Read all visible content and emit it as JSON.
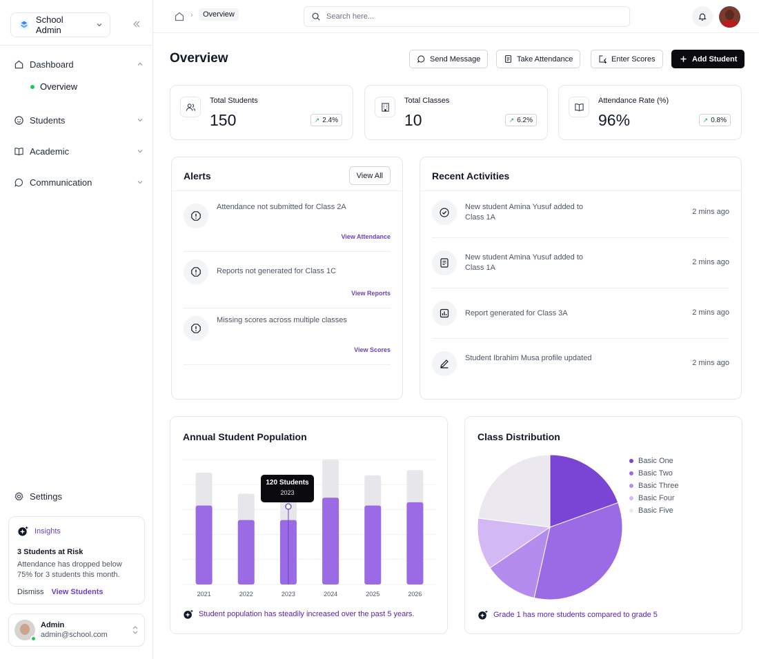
{
  "app": {
    "name": "School Admin"
  },
  "sidebar": {
    "nav": [
      {
        "label": "Dashboard",
        "icon": "home-icon",
        "expanded": true
      },
      {
        "label": "Students",
        "icon": "smile-icon",
        "expanded": false
      },
      {
        "label": "Academic",
        "icon": "book-icon",
        "expanded": false
      },
      {
        "label": "Communication",
        "icon": "chat-icon",
        "expanded": false
      }
    ],
    "subitem": {
      "label": "Overview"
    },
    "settings": {
      "label": "Settings"
    },
    "insights": {
      "title": "Insights",
      "headline": "3 Students at Risk",
      "text": "Attendance has dropped below 75% for 3 students this month.",
      "dismiss": "Dismiss",
      "view": "View Students"
    },
    "user": {
      "name": "Admin",
      "email": "admin@school.com"
    }
  },
  "topbar": {
    "breadcrumb": "Overview",
    "search_placeholder": "Search here..."
  },
  "main": {
    "title": "Overview",
    "actions": {
      "send_message": "Send Message",
      "take_attendance": "Take Attendance",
      "enter_scores": "Enter Scores",
      "add_student": "Add Student"
    },
    "stats": [
      {
        "label": "Total Students",
        "value": "150",
        "change": "2.4%"
      },
      {
        "label": "Total Classes",
        "value": "10",
        "change": "6.2%"
      },
      {
        "label": "Attendance Rate (%)",
        "value": "96%",
        "change": "0.8%"
      }
    ],
    "alerts": {
      "title": "Alerts",
      "view_all": "View All",
      "items": [
        {
          "text": "Attendance not submitted for Class 2A",
          "link": "View Attendance"
        },
        {
          "text": "Reports not generated for Class 1C",
          "link": "View Reports"
        },
        {
          "text": "Missing scores across multiple classes",
          "link": "View Scores"
        }
      ]
    },
    "activities": {
      "title": "Recent Activities",
      "items": [
        {
          "text": "New student Amina Yusuf added to Class 1A",
          "time": "2 mins ago",
          "icon": "check-circle-icon"
        },
        {
          "text": "New student Amina Yusuf added to Class 1A",
          "time": "2 mins ago",
          "icon": "document-icon"
        },
        {
          "text": "Report generated for Class 3A",
          "time": "2 mins ago",
          "icon": "report-chart-icon"
        },
        {
          "text": "Student Ibrahim Musa profile updated",
          "time": "2 mins ago",
          "icon": "pencil-icon"
        }
      ]
    },
    "population": {
      "title": "Annual Student Population",
      "tooltip": {
        "value": "120 Students",
        "year": "2023"
      },
      "insight": "Student population has steadily increased over the past 5 years."
    },
    "distribution": {
      "title": "Class Distribution",
      "insight": "Grade 1 has more students compared to grade 5"
    }
  },
  "chart_data": [
    {
      "type": "bar",
      "title": "Annual Student Population",
      "categories": [
        "2021",
        "2022",
        "2023",
        "2024",
        "2025",
        "2026"
      ],
      "series": [
        {
          "values": [
            120,
            98,
            98,
            132,
            120,
            125
          ],
          "color": "#9b6be6"
        },
        {
          "values": [
            170,
            138,
            142,
            190,
            166,
            174
          ],
          "color": "#e7e6ea"
        }
      ],
      "ylim": [
        0,
        190
      ],
      "grid": true
    },
    {
      "type": "pie",
      "title": "Class Distribution",
      "labels": [
        "Basic One",
        "Basic Two",
        "Basic Three",
        "Basic Four",
        "Basic Five"
      ],
      "values": [
        19.5,
        34,
        12,
        11.5,
        23
      ],
      "colors": [
        "#7a44d4",
        "#9b6be6",
        "#b48cee",
        "#d3b8f6",
        "#ebe9ef"
      ]
    }
  ]
}
